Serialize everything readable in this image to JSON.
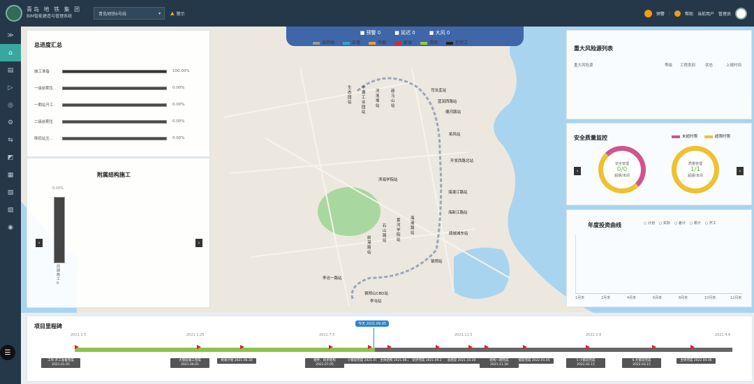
{
  "header": {
    "brand_line1": "青岛 地 铁 集 团",
    "brand_line2": "BIM智能建造与管理系统",
    "project_select": "青岛地铁6号线",
    "warning_label": "警示",
    "alarm_label": "预警",
    "help_label": "帮助",
    "user_label": "当前用户",
    "role_label": "管理员"
  },
  "sidebar": {
    "items": [
      "≫",
      "⌂",
      "▤",
      "▷",
      "◎",
      "⚙",
      "⇆",
      "◩",
      "▦",
      "▧",
      "▨",
      "◉"
    ]
  },
  "map_legend": {
    "counts": [
      {
        "label": "预警",
        "value": "0"
      },
      {
        "label": "延迟",
        "value": "0"
      },
      {
        "label": "大风",
        "value": "0"
      }
    ],
    "statuses": [
      {
        "label": "未开始",
        "color": "#9b9b9b"
      },
      {
        "label": "正常",
        "color": "#2aa6d9"
      },
      {
        "label": "节假",
        "color": "#f09a3a"
      },
      {
        "label": "延误",
        "color": "#d42b2b"
      },
      {
        "label": "提前",
        "color": "#9acd32"
      },
      {
        "label": "已完工",
        "color": "#222222"
      }
    ]
  },
  "summary": {
    "title": "总进度汇总",
    "rows": [
      {
        "label": "施工准备",
        "pct": "100.00%",
        "fill": 1.0
      },
      {
        "label": "一级前期生",
        "pct": "0.00%",
        "fill": 0
      },
      {
        "label": "一期站开工",
        "pct": "0.00%",
        "fill": 0
      },
      {
        "label": "二级前期生",
        "pct": "0.00%",
        "fill": 0
      },
      {
        "label": "降低站生...",
        "pct": "0.00%",
        "fill": 0
      }
    ]
  },
  "attached": {
    "title": "附属结构施工",
    "bar_pct": "0.00%",
    "bar_label": "前期施工0"
  },
  "risk": {
    "title": "重大风险源列表",
    "cols": [
      "重大风险源",
      "等级",
      "工程类别",
      "状态",
      "上报时间"
    ]
  },
  "safety": {
    "title": "安全质量监控",
    "legend": [
      {
        "label": "未超时限",
        "color": "#d0548f"
      },
      {
        "label": "超限时限",
        "color": "#f0c030"
      }
    ],
    "rings": [
      {
        "label": "安全管理",
        "value": "0/0",
        "sub": "超期/未闭"
      },
      {
        "label": "质量管理",
        "value": "1/1",
        "sub": "超期/未闭"
      }
    ]
  },
  "investment": {
    "title": "年度投资曲线",
    "options": [
      "计划",
      "实际",
      "差计",
      "累计",
      "开工"
    ],
    "months": [
      "1月末",
      "2月末",
      "4月末",
      "6月末",
      "8月末",
      "10月末",
      "12月末"
    ]
  },
  "stations": {
    "horizontal": [
      "司法孟站",
      "蓝润西路站",
      "顺河路站",
      "拓风站",
      "开发西路北站",
      "滨海学院站",
      "海港江路站",
      "海新江路站",
      "疏城城东站",
      "钢郑站",
      "李沧一路站",
      "钢郑山CBD站",
      "李屯站"
    ],
    "vertical": [
      "生态园站",
      "中德工业园站",
      "河洛埠站",
      "疏马山站",
      "石山路站",
      "黄河学院站",
      "海港路站",
      "前港路站"
    ]
  },
  "timeline": {
    "title": "项目里程碑",
    "current": "今天 2021.09.05",
    "ticks": [
      "2021.1.5",
      "2021.1.25",
      "2021.7.5",
      "2021.11.5",
      "2022.1.6",
      "2022.4.6"
    ],
    "milestones": [
      "工作-开工准备完成 2021.01.05",
      "大管段施工完成 2021.06.01",
      "始发计划 2021.06.30",
      "组件、初步结构 2021.07.05",
      "小管段完成 2021.01",
      "主体结构 2021.08.20",
      "初步完成 2021.09.20",
      "总结段 2021.10.20",
      "结构一期完成 2021.11.30",
      "提前完成 2022.01.05",
      "5.小管段完成 2022.02.15",
      "6.大管段完成 2022.03.15",
      "主体完成 2022.04.06"
    ]
  }
}
